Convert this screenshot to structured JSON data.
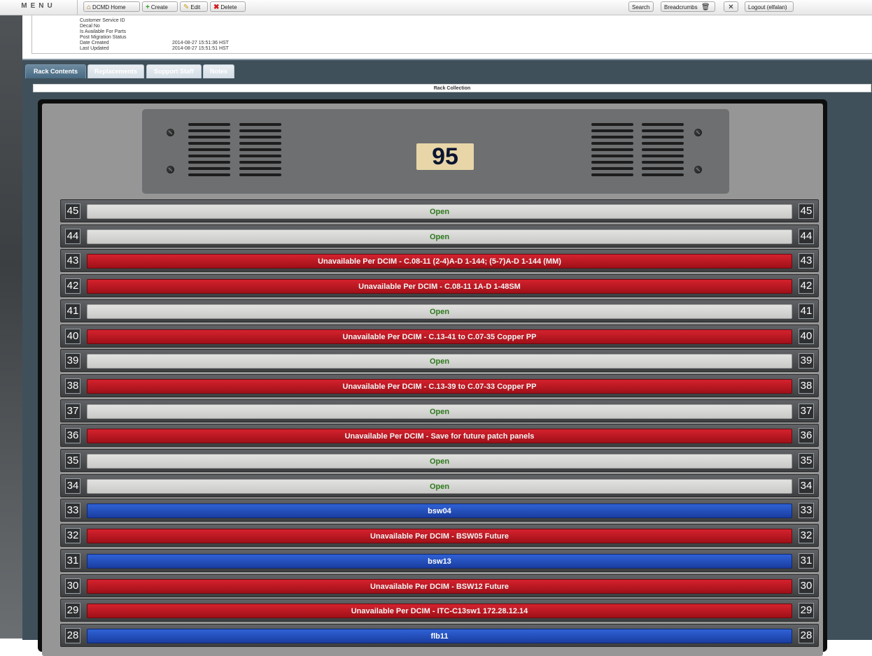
{
  "menu": {
    "label": "MENU"
  },
  "toolbar": {
    "home": "DCMD Home",
    "create": "Create",
    "edit": "Edit",
    "delete": "Delete",
    "search": "Search",
    "breadcrumbs": "Breadcrumbs",
    "logout": "Logout (elfalan)"
  },
  "details": [
    {
      "label": "Customer Service ID",
      "value": ""
    },
    {
      "label": "Decal No",
      "value": ""
    },
    {
      "label": "Is Available For Parts",
      "value": ""
    },
    {
      "label": "Post Migration Status",
      "value": ""
    },
    {
      "label": "Date Created",
      "value": "2014-08-27 15:51:36 HST"
    },
    {
      "label": "Last Updated",
      "value": "2014-08-27 15:51:51 HST"
    }
  ],
  "tabs": [
    {
      "label": "Rack Contents",
      "active": true
    },
    {
      "label": "Replacements",
      "active": false
    },
    {
      "label": "Support Staff",
      "active": false
    },
    {
      "label": "Notes",
      "active": false
    }
  ],
  "rack": {
    "collection_title": "Rack Collection",
    "number": "95",
    "colors": {
      "open": "#d6d6d4",
      "unavailable": "#c01a24",
      "device": "#2552c4",
      "open_text": "#2d7a1c"
    },
    "slots": [
      {
        "unit": "45",
        "label": "Open",
        "status": "open"
      },
      {
        "unit": "44",
        "label": "Open",
        "status": "open"
      },
      {
        "unit": "43",
        "label": "Unavailable Per DCIM - C.08-11 (2-4)A-D 1-144; (5-7)A-D 1-144 (MM)",
        "status": "unavailable"
      },
      {
        "unit": "42",
        "label": "Unavailable Per DCIM - C.08-11 1A-D 1-48SM",
        "status": "unavailable"
      },
      {
        "unit": "41",
        "label": "Open",
        "status": "open"
      },
      {
        "unit": "40",
        "label": "Unavailable Per DCIM - C.13-41 to C.07-35 Copper PP",
        "status": "unavailable"
      },
      {
        "unit": "39",
        "label": "Open",
        "status": "open"
      },
      {
        "unit": "38",
        "label": "Unavailable Per DCIM - C.13-39 to C.07-33 Copper PP",
        "status": "unavailable"
      },
      {
        "unit": "37",
        "label": "Open",
        "status": "open"
      },
      {
        "unit": "36",
        "label": "Unavailable Per DCIM - Save for future patch panels",
        "status": "unavailable"
      },
      {
        "unit": "35",
        "label": "Open",
        "status": "open"
      },
      {
        "unit": "34",
        "label": "Open",
        "status": "open"
      },
      {
        "unit": "33",
        "label": "bsw04",
        "status": "device"
      },
      {
        "unit": "32",
        "label": "Unavailable Per DCIM - BSW05 Future",
        "status": "unavailable"
      },
      {
        "unit": "31",
        "label": "bsw13",
        "status": "device"
      },
      {
        "unit": "30",
        "label": "Unavailable Per DCIM - BSW12 Future",
        "status": "unavailable"
      },
      {
        "unit": "29",
        "label": "Unavailable Per DCIM - ITC-C13sw1 172.28.12.14",
        "status": "unavailable"
      },
      {
        "unit": "28",
        "label": "flb11",
        "status": "device"
      }
    ]
  }
}
